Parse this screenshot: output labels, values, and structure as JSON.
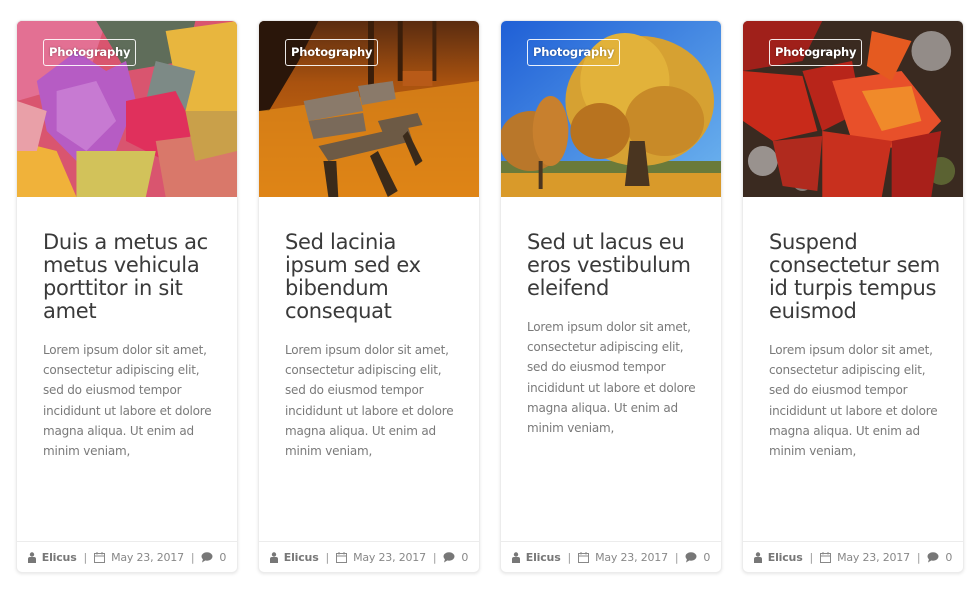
{
  "posts": [
    {
      "category": "Photography",
      "image": "colorful-maple-leaves-photo",
      "title": "Duis a metus ac metus vehicula porttitor in sit amet",
      "excerpt": "Lorem ipsum dolor sit amet, consectetur adipiscing elit, sed do eiusmod tempor incididunt ut labore et dolore magna aliqua. Ut enim ad minim veniam,",
      "author": "Elicus",
      "date": "May 23, 2017",
      "comments": "0"
    },
    {
      "category": "Photography",
      "image": "park-bench-autumn-photo",
      "title": "Sed lacinia ipsum sed ex bibendum consequat",
      "excerpt": "Lorem ipsum dolor sit amet, consectetur adipiscing elit, sed do eiusmod tempor incididunt ut labore et dolore magna aliqua. Ut enim ad minim veniam,",
      "author": "Elicus",
      "date": "May 23, 2017",
      "comments": "0"
    },
    {
      "category": "Photography",
      "image": "autumn-tree-blue-sky-photo",
      "title": "Sed ut lacus eu eros vestibulum eleifend",
      "excerpt": "Lorem ipsum dolor sit amet, consectetur adipiscing elit, sed do eiusmod tempor incididunt ut labore et dolore magna aliqua. Ut enim ad minim veniam,",
      "author": "Elicus",
      "date": "May 23, 2017",
      "comments": "0"
    },
    {
      "category": "Photography",
      "image": "red-oak-leaves-photo",
      "title": "Suspend consectetur sem id turpis tempus euismod",
      "excerpt": "Lorem ipsum dolor sit amet, consectetur adipiscing elit, sed do eiusmod tempor incididunt ut labore et dolore magna aliqua. Ut enim ad minim veniam,",
      "author": "Elicus",
      "date": "May 23, 2017",
      "comments": "0"
    }
  ],
  "meta_separator": "|",
  "icons": {
    "author": "user-icon",
    "date": "calendar-icon",
    "comments": "comment-icon"
  }
}
